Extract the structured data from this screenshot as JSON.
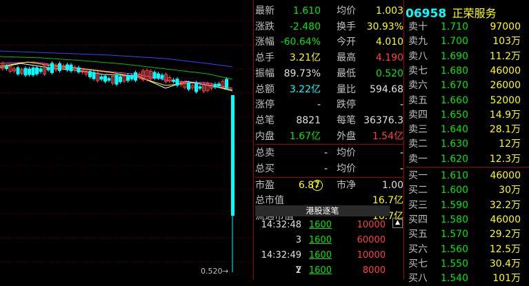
{
  "stats": {
    "left": [
      {
        "label": "最新",
        "value": "1.610",
        "color": "g"
      },
      {
        "label": "涨跌",
        "value": "-2.480",
        "color": "g"
      },
      {
        "label": "涨幅",
        "value": "-60.64%",
        "color": "g"
      },
      {
        "label": "总手",
        "value": "3.21亿",
        "color": "y"
      },
      {
        "label": "振幅",
        "value": "89.73%",
        "color": "w"
      },
      {
        "label": "总额",
        "value": "3.22亿",
        "color": "c"
      },
      {
        "label": "涨停",
        "value": "-",
        "color": "w"
      },
      {
        "label": "总笔",
        "value": "8821",
        "color": "w"
      },
      {
        "label": "内盘",
        "value": "1.67亿",
        "color": "g"
      }
    ],
    "right": [
      {
        "label": "均价",
        "value": "1.003",
        "color": "y"
      },
      {
        "label": "换手",
        "value": "30.93%",
        "color": "y"
      },
      {
        "label": "今开",
        "value": "4.010",
        "color": "y"
      },
      {
        "label": "最高",
        "value": "4.190",
        "color": "r"
      },
      {
        "label": "最低",
        "value": "0.520",
        "color": "g"
      },
      {
        "label": "量比",
        "value": "594.68",
        "color": "w"
      },
      {
        "label": "跌停",
        "value": "-",
        "color": "w"
      },
      {
        "label": "每笔",
        "value": "36376.3",
        "color": "w"
      },
      {
        "label": "外盘",
        "value": "1.54亿",
        "color": "r"
      }
    ],
    "sell_total": {
      "label": "总卖",
      "value": "-",
      "label2": "均价",
      "value2": "-"
    },
    "buy_total": {
      "label": "总买",
      "value": "-",
      "label2": "均价",
      "value2": "-"
    },
    "pe": {
      "label": "市盈",
      "value": "6.87",
      "mark": "2",
      "label2": "市净",
      "value2": "1.00"
    },
    "mcap": {
      "label": "总市值",
      "value": "16.7亿"
    },
    "float_mcap": {
      "label": "流通市值",
      "value": "16.7亿"
    }
  },
  "stock": {
    "code": "06958",
    "name": "正荣服务"
  },
  "sell_orders": [
    {
      "label": "卖十",
      "price": "1.710",
      "vol": "97000"
    },
    {
      "label": "卖九",
      "price": "1.700",
      "vol": "103万"
    },
    {
      "label": "卖八",
      "price": "1.690",
      "vol": "11.2万"
    },
    {
      "label": "卖七",
      "price": "1.680",
      "vol": "46000"
    },
    {
      "label": "卖六",
      "price": "1.670",
      "vol": "26000"
    },
    {
      "label": "卖五",
      "price": "1.660",
      "vol": "52000"
    },
    {
      "label": "卖四",
      "price": "1.650",
      "vol": "14.9万"
    },
    {
      "label": "卖三",
      "price": "1.640",
      "vol": "28.1万"
    },
    {
      "label": "卖二",
      "price": "1.630",
      "vol": "12万"
    },
    {
      "label": "卖一",
      "price": "1.620",
      "vol": "12.3万"
    }
  ],
  "buy_orders": [
    {
      "label": "买一",
      "price": "1.610",
      "vol": "46000"
    },
    {
      "label": "买二",
      "price": "1.600",
      "vol": "30万"
    },
    {
      "label": "买三",
      "price": "1.590",
      "vol": "32.2万"
    },
    {
      "label": "买四",
      "price": "1.580",
      "vol": "46000"
    },
    {
      "label": "买五",
      "price": "1.570",
      "vol": "29.2万"
    },
    {
      "label": "买六",
      "price": "1.560",
      "vol": "12.5万"
    },
    {
      "label": "买七",
      "price": "1.550",
      "vol": "30.4万"
    },
    {
      "label": "买八",
      "price": "1.540",
      "vol": "101万"
    }
  ],
  "ticks": {
    "title": "港股逐笔",
    "rows": [
      {
        "time": "14:32:48",
        "price": "1600",
        "vol": "10000"
      },
      {
        "time": "3",
        "price": "1600",
        "vol": "60000"
      },
      {
        "time": "14:32:49 Y",
        "price": "1600",
        "vol": "10000"
      },
      {
        "time": "2",
        "price": "1600",
        "vol": "8000"
      }
    ]
  },
  "chart": {
    "low_label": "0.520"
  },
  "colors": {
    "green": "#00e600",
    "yellow": "#ffff00",
    "red": "#ff4040",
    "cyan": "#00ffff",
    "grid": "#a00000"
  }
}
